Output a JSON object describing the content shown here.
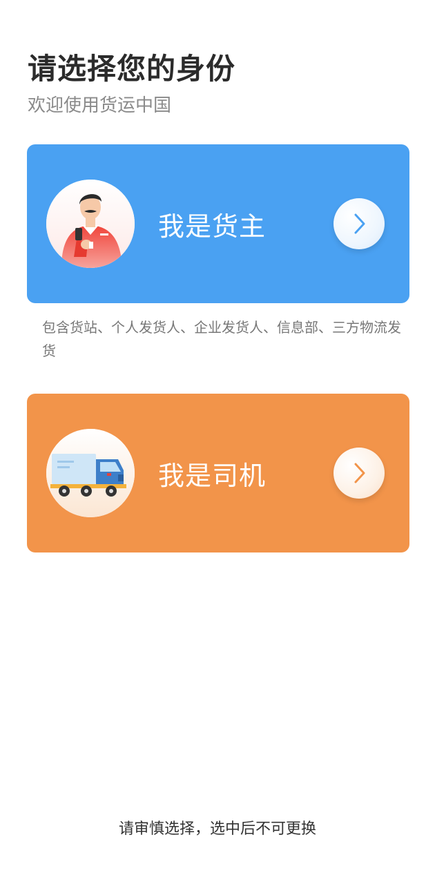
{
  "header": {
    "title": "请选择您的身份",
    "subtitle": "欢迎使用货运中国"
  },
  "roles": [
    {
      "label": "我是货主",
      "description": "包含货站、个人发货人、企业发货人、信息部、三方物流发货",
      "color": "#4aa1f2",
      "icon": "shipper-avatar-icon"
    },
    {
      "label": "我是司机",
      "color": "#f2944a",
      "icon": "truck-icon"
    }
  ],
  "footer": {
    "note": "请审慎选择，选中后不可更换"
  }
}
